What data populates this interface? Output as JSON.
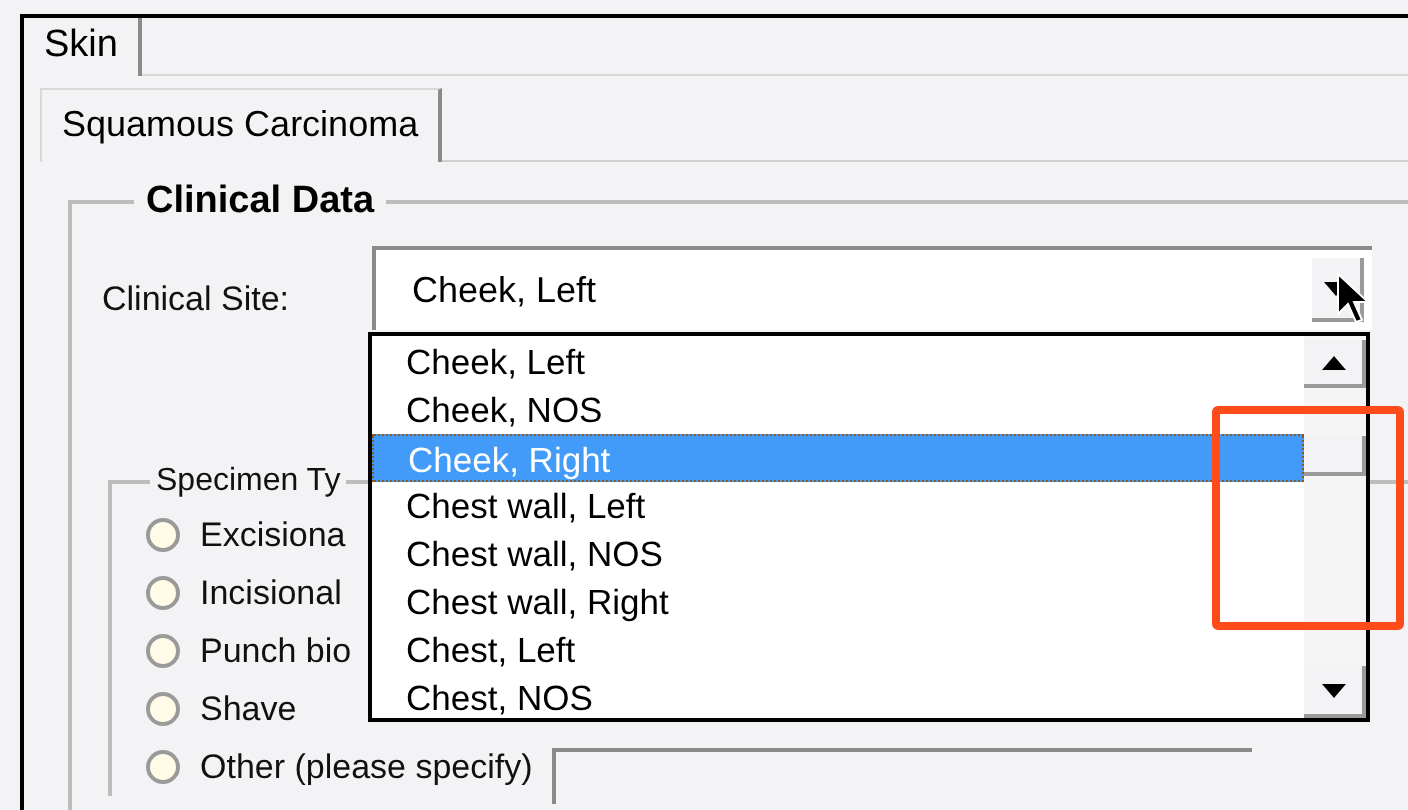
{
  "outer_tabs": [
    {
      "label": "Skin",
      "selected": true
    }
  ],
  "inner_tabs": [
    {
      "label": "Squamous Carcinoma",
      "selected": true
    }
  ],
  "clinical_data": {
    "title": "Clinical Data",
    "site_label": "Clinical Site:",
    "site_value": "Cheek, Left",
    "dropdown": {
      "expanded": true,
      "options": [
        {
          "label": "Cheek, Left",
          "selected": false
        },
        {
          "label": "Cheek, NOS",
          "selected": false
        },
        {
          "label": "Cheek, Right",
          "selected": true
        },
        {
          "label": "Chest wall, Left",
          "selected": false
        },
        {
          "label": "Chest wall, NOS",
          "selected": false
        },
        {
          "label": "Chest wall, Right",
          "selected": false
        },
        {
          "label": "Chest, Left",
          "selected": false
        },
        {
          "label": "Chest, NOS",
          "selected": false
        }
      ]
    }
  },
  "specimen_type": {
    "title": "Specimen Ty",
    "options": [
      {
        "label": "Excisiona",
        "selected": false
      },
      {
        "label": "Incisional",
        "selected": false
      },
      {
        "label": "Punch bio",
        "selected": false
      },
      {
        "label": "Shave",
        "selected": false
      },
      {
        "label": "Other (please specify)",
        "selected": false,
        "kind": "with_field"
      }
    ]
  },
  "annotation": {
    "kind": "highlight",
    "color": "#ff4a1a"
  }
}
